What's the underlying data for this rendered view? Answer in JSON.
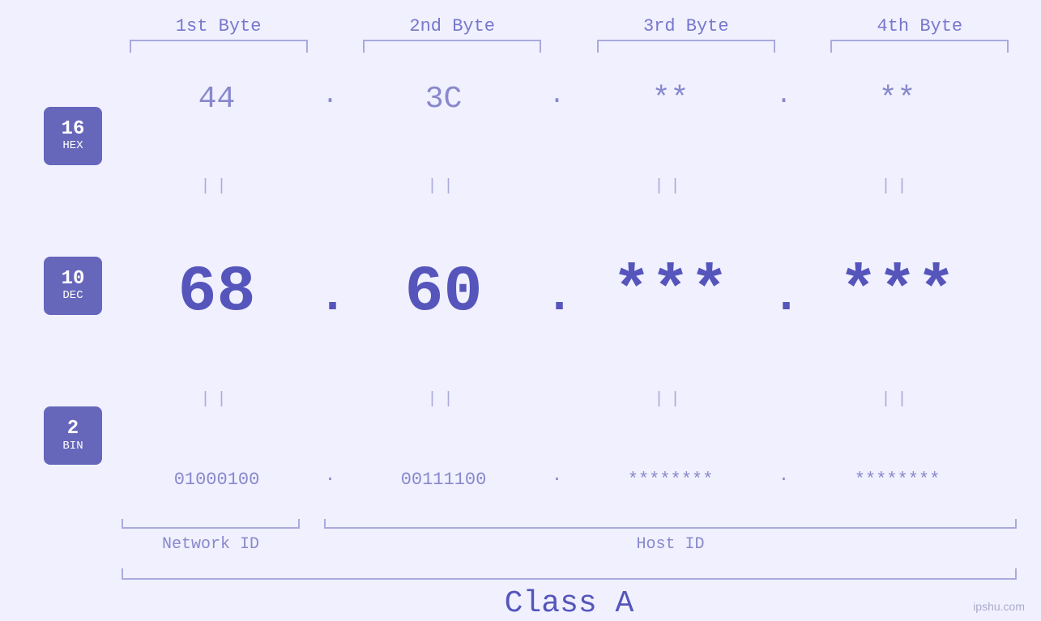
{
  "header": {
    "byte1": "1st Byte",
    "byte2": "2nd Byte",
    "byte3": "3rd Byte",
    "byte4": "4th Byte"
  },
  "badges": {
    "hex": {
      "number": "16",
      "label": "HEX"
    },
    "dec": {
      "number": "10",
      "label": "DEC"
    },
    "bin": {
      "number": "2",
      "label": "BIN"
    }
  },
  "hex_row": {
    "b1": "44",
    "b2": "3C",
    "b3": "**",
    "b4": "**",
    "sep": "."
  },
  "dec_row": {
    "b1": "68",
    "b2": "60",
    "b3": "***",
    "b4": "***",
    "sep": "."
  },
  "bin_row": {
    "b1": "01000100",
    "b2": "00111100",
    "b3": "********",
    "b4": "********",
    "sep": "."
  },
  "labels": {
    "network_id": "Network ID",
    "host_id": "Host ID",
    "class": "Class A"
  },
  "watermark": "ipshu.com"
}
